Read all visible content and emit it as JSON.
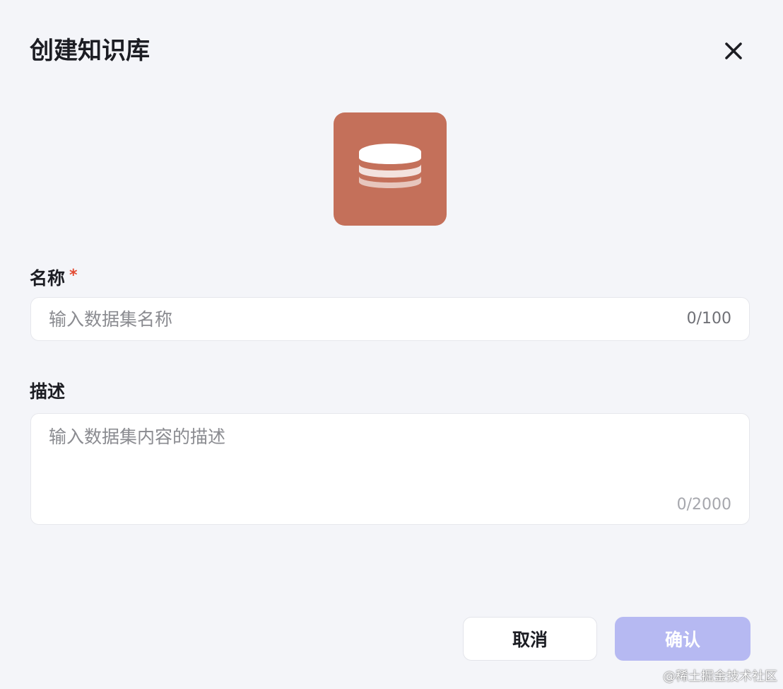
{
  "dialog": {
    "title": "创建知识库",
    "close_icon": "close-icon",
    "icon": {
      "name": "database-icon",
      "background": "#c4705a"
    },
    "name_field": {
      "label": "名称",
      "required_mark": "*",
      "placeholder": "输入数据集名称",
      "value": "",
      "counter": "0/100"
    },
    "description_field": {
      "label": "描述",
      "placeholder": "输入数据集内容的描述",
      "value": "",
      "counter": "0/2000"
    },
    "buttons": {
      "cancel": "取消",
      "confirm": "确认"
    }
  },
  "colors": {
    "background": "#f4f5f9",
    "required": "#e24a32",
    "confirm_disabled": "#b6b9f2"
  },
  "watermark": "@稀土掘金技术社区"
}
